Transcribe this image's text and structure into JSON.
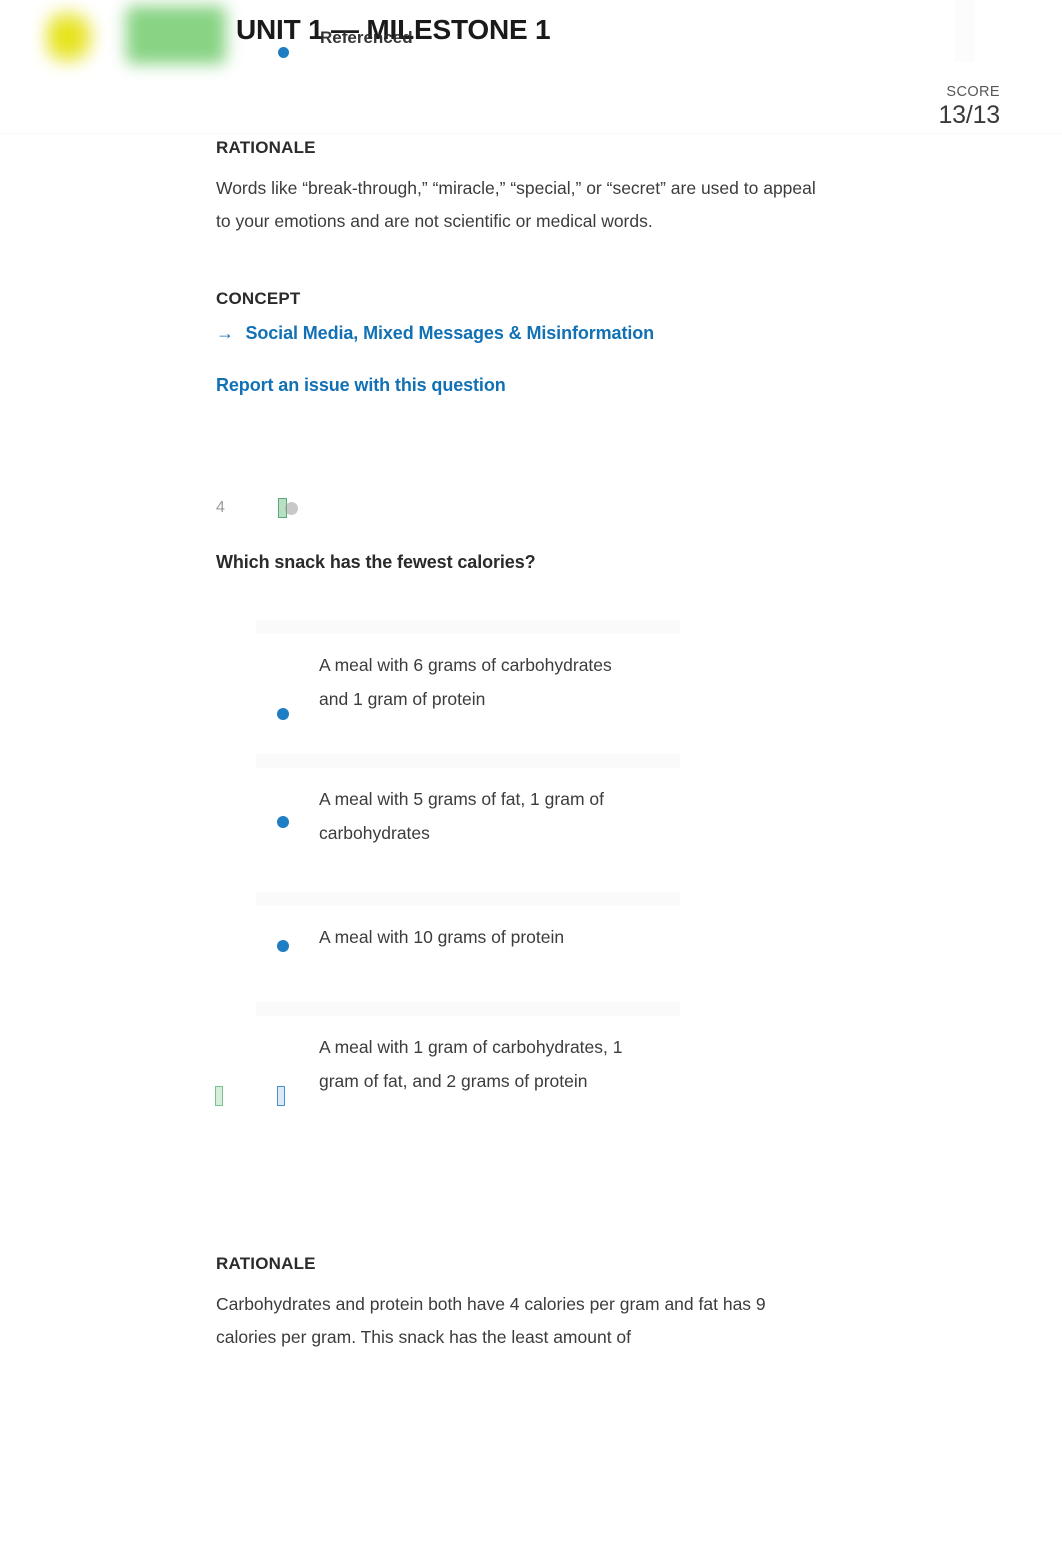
{
  "header": {
    "unit_title": "UNIT 1 — MILESTONE 1",
    "overlay_text": "Referenced",
    "score_label": "SCORE",
    "score_value": "13/13",
    "logo_yellow_name": "blurred-yellow-logo",
    "logo_green_name": "blurred-green-logo",
    "accent_blue": "#1f7dc4"
  },
  "rationale_top": {
    "heading": "RATIONALE",
    "text": "Words like “break-through,” “miracle,” “special,” or “secret” are used to appeal to your emotions and are not scientific or medical words."
  },
  "concept": {
    "heading": "CONCEPT",
    "arrow": "→",
    "link_text": "Social Media, Mixed Messages & Misinformation"
  },
  "report_link": "Report an issue with this question",
  "question": {
    "number": "4",
    "icon": "answer-status-icon",
    "prompt": "Which snack has the fewest calories?",
    "options": [
      {
        "text": "A meal with 6 grams of carbohydrates and 1 gram of protein",
        "marker": "bullet-blue",
        "selected": false
      },
      {
        "text": "A meal with 5 grams of fat, 1 gram of carbohydrates",
        "marker": "bullet-blue",
        "selected": false
      },
      {
        "text": "A meal with 10 grams of protein",
        "marker": "bullet-blue",
        "selected": false
      },
      {
        "text": "A meal with 1 gram of carbohydrates, 1 gram of fat, and 2 grams of protein",
        "marker": "correct-and-selected-glyphs",
        "selected": true
      }
    ]
  },
  "rationale_bottom": {
    "heading": "RATIONALE",
    "text": "Carbohydrates and protein both have 4 calories per gram and fat has 9 calories per gram. This snack has the least amount of"
  }
}
